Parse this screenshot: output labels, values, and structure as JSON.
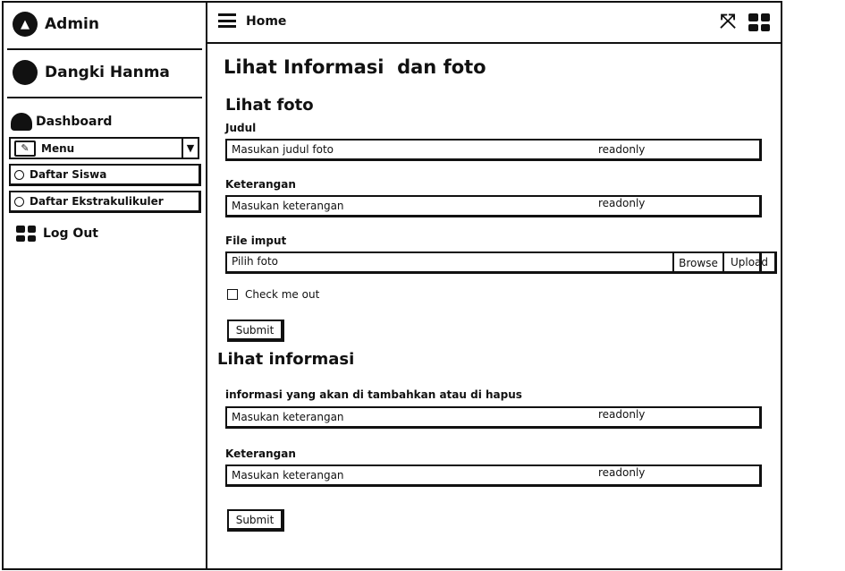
{
  "sidebar": {
    "brand": "Admin",
    "user": "Dangki Hanma",
    "dashboard": "Dashboard",
    "menu": "Menu",
    "items": [
      {
        "label": "Daftar Siswa"
      },
      {
        "label": "Daftar Ekstrakulikuler"
      }
    ],
    "logout": "Log Out"
  },
  "header": {
    "home": "Home"
  },
  "page": {
    "title": "Lihat Informasi  dan foto"
  },
  "foto_section": {
    "heading": "Lihat foto",
    "judul_label": "Judul",
    "judul_placeholder": "Masukan judul foto",
    "judul_readonly": "readonly",
    "keterangan_label": "Keterangan",
    "keterangan_placeholder": "Masukan keterangan",
    "keterangan_readonly": "readonly",
    "file_label": "File imput",
    "file_placeholder": "Pilih foto",
    "browse": "Browse",
    "upload": "Upload",
    "checkbox": "Check me out",
    "submit": "Submit"
  },
  "info_section": {
    "heading": "Lihat informasi",
    "info_label": "informasi yang akan di tambahkan atau di hapus",
    "info_placeholder": "Masukan keterangan",
    "info_readonly": "readonly",
    "keterangan_label": "Keterangan",
    "keterangan_placeholder": "Masukan keterangan",
    "keterangan_readonly": "readonly",
    "submit": "Submit"
  }
}
